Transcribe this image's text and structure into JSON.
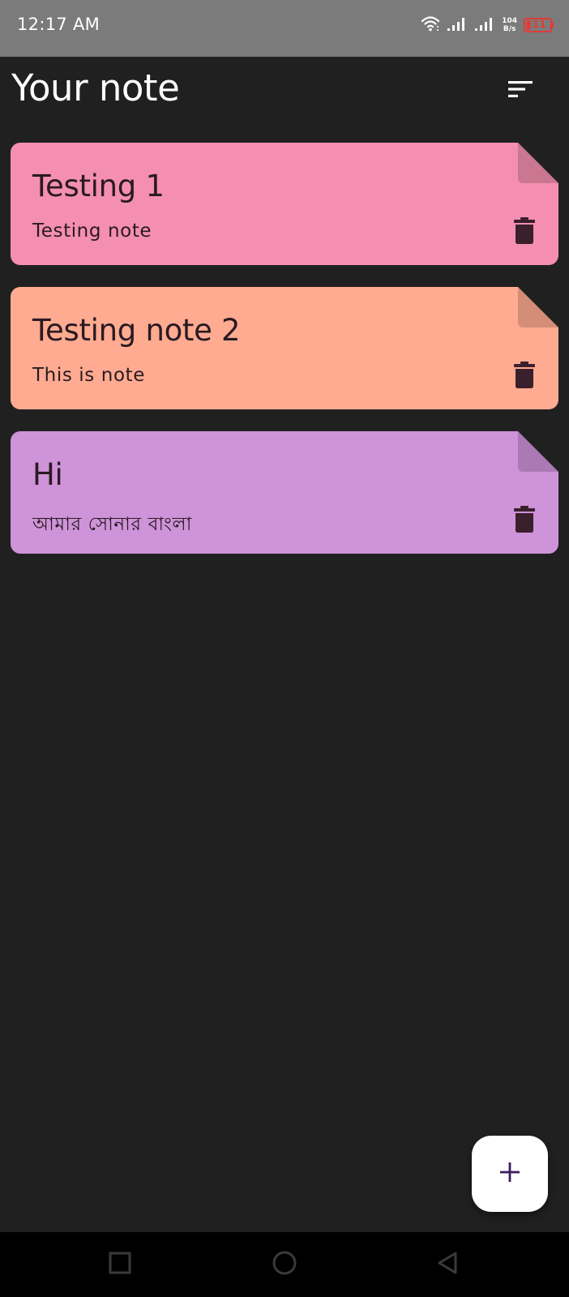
{
  "status_bar": {
    "time": "12:17 AM",
    "net_speed_value": "104",
    "net_speed_unit": "B/s",
    "battery_level": "11",
    "icons": [
      "wifi-icon",
      "signal-icon",
      "signal-icon",
      "battery-icon"
    ]
  },
  "app_bar": {
    "title": "Your note",
    "sort_icon": "sort-icon"
  },
  "notes": [
    {
      "title": "Testing 1",
      "body": "Testing note",
      "color": "#f48fb1",
      "fold_color": "#cc7792",
      "delete_icon": "trash-icon"
    },
    {
      "title": "Testing note 2",
      "body": "This is note",
      "color": "#ffab91",
      "fold_color": "#d48e78",
      "delete_icon": "trash-icon"
    },
    {
      "title": "Hi",
      "body": "আমার সোনার বাংলা",
      "color": "#ce93d8",
      "fold_color": "#ab79b4",
      "delete_icon": "trash-icon"
    }
  ],
  "fab": {
    "icon": "plus-icon",
    "icon_color": "#3b1d5e"
  },
  "nav_bar": {
    "icons": [
      "recent-apps-icon",
      "home-icon",
      "back-icon"
    ]
  },
  "colors": {
    "background": "#202020",
    "status_bar": "#7b7b7b",
    "note_text": "#2a1a22",
    "trash": "#3a1f2c"
  }
}
